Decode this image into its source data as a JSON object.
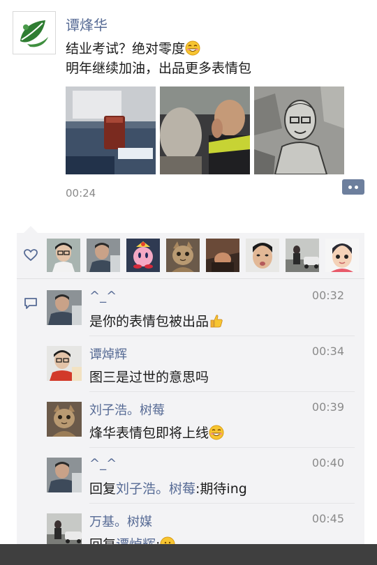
{
  "post": {
    "author": "谭烽华",
    "text_line1": "结业考试？绝对零度",
    "text_line2": "明年继续加油，出品更多表情包",
    "timestamp": "00:24",
    "photos": [
      {
        "alt": "photo-1-desk-cup"
      },
      {
        "alt": "photo-2-people"
      },
      {
        "alt": "photo-3-sketch-portrait"
      }
    ]
  },
  "likes": {
    "count": 8
  },
  "comments": [
    {
      "name": "^_^",
      "time": "00:32",
      "text": "是你的表情包被出品",
      "emoji": "thumbs-up-icon"
    },
    {
      "name": "谭焯辉",
      "time": "00:34",
      "text": "图三是过世的意思吗"
    },
    {
      "name": "刘子浩。树莓",
      "time": "00:39",
      "text": "烽华表情包即将上线",
      "emoji": "grin-emoji-icon"
    },
    {
      "name": "^_^",
      "time": "00:40",
      "reply_prefix": "回复",
      "reply_to": "刘子浩。树莓",
      "reply_text": ":期待ing"
    },
    {
      "name": "万基。树媒",
      "time": "00:45",
      "reply_prefix": "回复",
      "reply_to": "谭焯辉",
      "reply_text": ":"
    }
  ],
  "colors": {
    "link_blue": "#576b95",
    "panel_bg": "#f3f3f5",
    "timestamp_gray": "#8a8a8a"
  }
}
